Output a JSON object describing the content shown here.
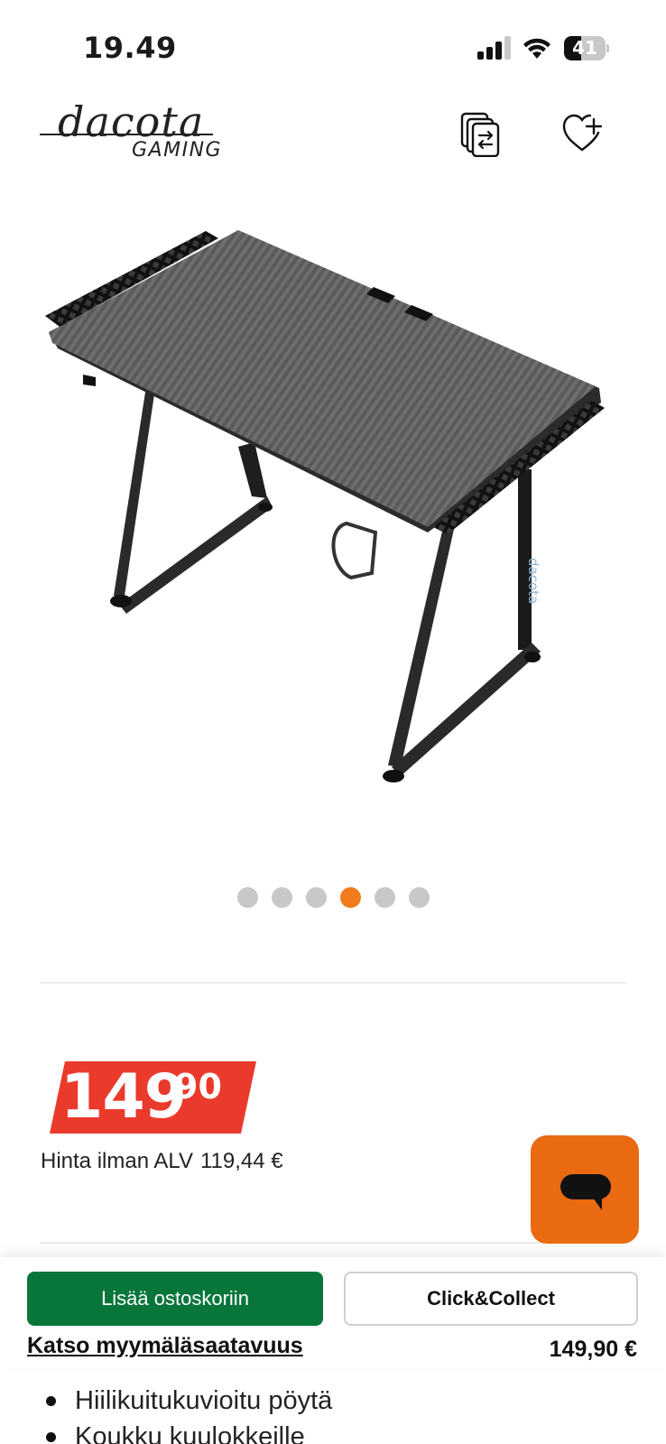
{
  "status_bar": {
    "time": "19.49",
    "battery_level": "41",
    "battery_fraction": 0.41,
    "icons": [
      "cellular-signal-icon",
      "wifi-icon",
      "battery-icon"
    ]
  },
  "header": {
    "logo_script": "dacota",
    "logo_sub": "GAMING",
    "icons": [
      "compare-icon",
      "heart-plus-icon"
    ]
  },
  "gallery": {
    "slide_count": 6,
    "active_index": 3,
    "accent_color": "#f07c1b"
  },
  "price": {
    "whole": "149",
    "cents": "90",
    "vat_label": "Hinta ilman ALV",
    "vat_value": "119,44 €",
    "tag_color": "#ea3a2b"
  },
  "chat": {
    "icon": "chat-bubble-icon",
    "color": "#ea6a11"
  },
  "actions": {
    "add_to_cart": "Lisää ostoskoriin",
    "click_collect": "Click&Collect",
    "store_availability": "Katso myymäläsaatavuus",
    "price": "149,90 €",
    "primary_color": "#08763b"
  },
  "features": [
    "Hiilikuitukuvioitu pöytä",
    "Koukku kuulokkeille"
  ]
}
